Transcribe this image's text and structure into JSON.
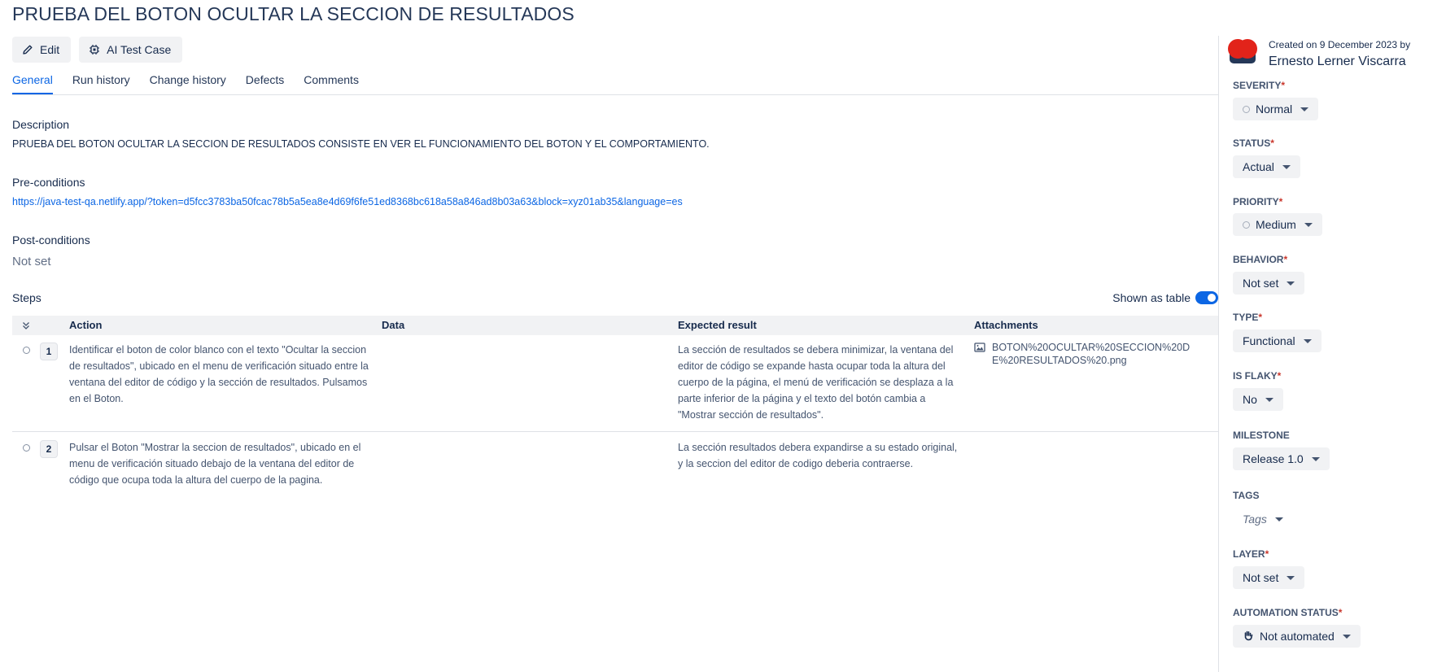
{
  "page": {
    "title": "PRUEBA DEL BOTON OCULTAR LA SECCION DE RESULTADOS"
  },
  "toolbar": {
    "edit_label": "Edit",
    "ai_label": "AI Test Case"
  },
  "tabs": [
    {
      "label": "General",
      "active": true
    },
    {
      "label": "Run history",
      "active": false
    },
    {
      "label": "Change history",
      "active": false
    },
    {
      "label": "Defects",
      "active": false
    },
    {
      "label": "Comments",
      "active": false
    }
  ],
  "description": {
    "label": "Description",
    "text": "PRUEBA DEL BOTON OCULTAR LA SECCION DE RESULTADOS CONSISTE EN VER EL FUNCIONAMIENTO DEL BOTON Y EL COMPORTAMIENTO."
  },
  "preconditions": {
    "label": "Pre-conditions",
    "link": "https://java-test-qa.netlify.app/?token=d5fcc3783ba50fcac78b5a5ea8e4d69f6fe51ed8368bc618a58a846ad8b03a63&block=xyz01ab35&language=es"
  },
  "postconditions": {
    "label": "Post-conditions",
    "value": "Not set"
  },
  "steps": {
    "label": "Steps",
    "shown_as_table_label": "Shown as table",
    "shown_as_table": true,
    "columns": {
      "action": "Action",
      "data": "Data",
      "expected": "Expected result",
      "attachments": "Attachments"
    },
    "rows": [
      {
        "number": "1",
        "action": "Identificar el boton de color blanco con el texto \"Ocultar la seccion de resultados\", ubicado en el menu de verificación situado entre la ventana del editor de código y la sección de resultados. Pulsamos en el Boton.",
        "data": "",
        "expected": "La sección de resultados se debera minimizar, la ventana del editor de código se expande hasta ocupar toda la altura del cuerpo de la página, el menú de verificación se desplaza a la parte inferior de la página y el texto del botón cambia a \"Mostrar sección de resultados\".",
        "attachment": "BOTON%20OCULTAR%20SECCION%20DE%20RESULTADOS%20.png"
      },
      {
        "number": "2",
        "action": "Pulsar el Boton \"Mostrar la seccion de resultados\", ubicado en el menu de verificación situado debajo de la ventana del editor de código que ocupa toda la altura del cuerpo de la pagina.",
        "data": "",
        "expected": "La sección resultados debera expandirse a su estado original, y la seccion del editor de codigo deberia contraerse.",
        "attachment": ""
      }
    ]
  },
  "sidebar": {
    "created": "Created on 9 December 2023 by",
    "author": "Ernesto Lerner Viscarra",
    "fields": {
      "severity": {
        "label": "SEVERITY",
        "value": "Normal"
      },
      "status": {
        "label": "STATUS",
        "value": "Actual"
      },
      "priority": {
        "label": "PRIORITY",
        "value": "Medium"
      },
      "behavior": {
        "label": "BEHAVIOR",
        "value": "Not set"
      },
      "type": {
        "label": "TYPE",
        "value": "Functional"
      },
      "is_flaky": {
        "label": "IS FLAKY",
        "value": "No"
      },
      "milestone": {
        "label": "MILESTONE",
        "value": "Release 1.0"
      },
      "tags": {
        "label": "TAGS",
        "value": "Tags"
      },
      "layer": {
        "label": "LAYER",
        "value": "Not set"
      },
      "automation_status": {
        "label": "AUTOMATION STATUS",
        "value": "Not automated"
      }
    },
    "required_mark": "*"
  },
  "colors": {
    "accent": "#0c66e4",
    "text": "#172b4d",
    "muted": "#626f86",
    "required": "#c9372c",
    "avatar": "#e2231a"
  },
  "icons": {
    "edit": "pencil-icon",
    "ai": "chip-icon",
    "collapse": "double-chevron-down-icon",
    "attachment": "image-icon",
    "automation": "hand-icon"
  }
}
